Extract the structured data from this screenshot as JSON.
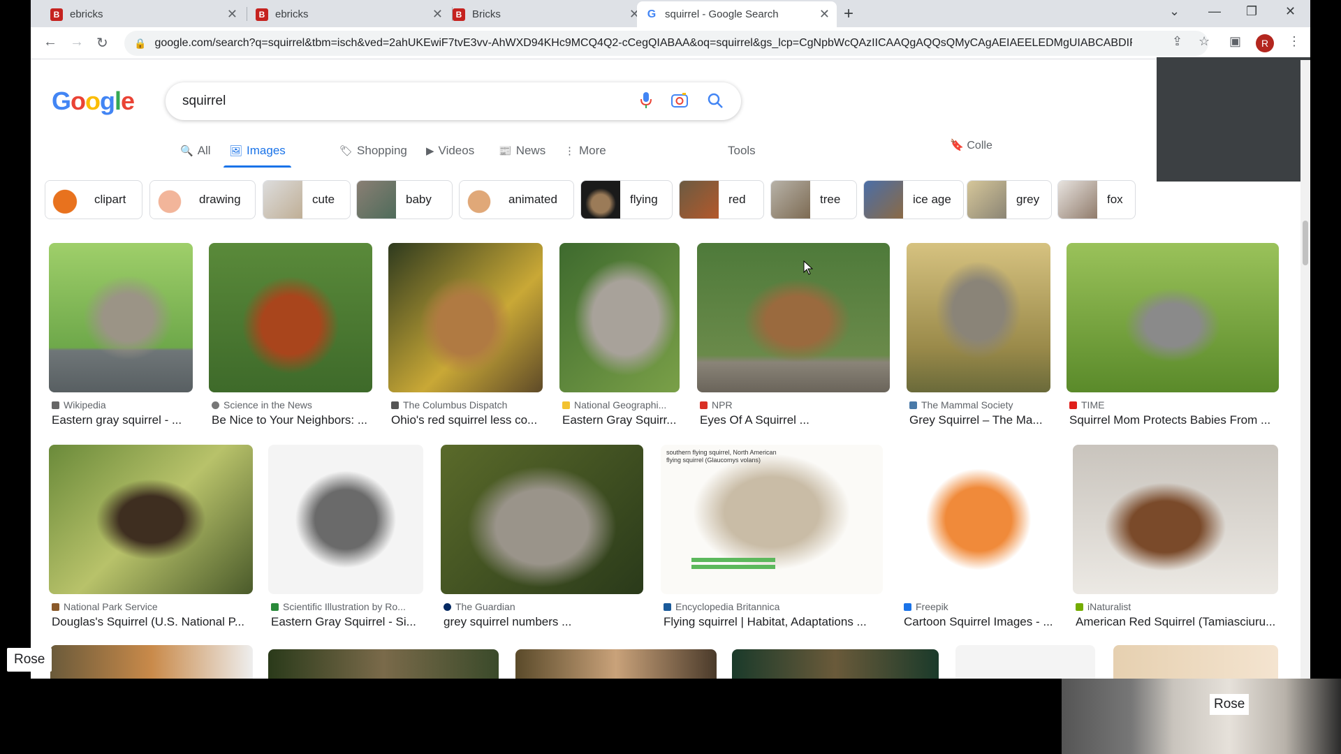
{
  "tabs": [
    {
      "title": "ebricks",
      "favicon": "B"
    },
    {
      "title": "ebricks",
      "favicon": "B"
    },
    {
      "title": "Bricks",
      "favicon": "B"
    },
    {
      "title": "squirrel - Google Search",
      "favicon": "G"
    }
  ],
  "address_bar": {
    "url": "google.com/search?q=squirrel&tbm=isch&ved=2ahUKEwiF7tvE3vv-AhWXD94KHc9MCQ4Q2-cCegQIABAA&oq=squirrel&gs_lcp=CgNpbWcQAzIICAAQgAQQsQMyCAgAEIAEELEDMgUIABCABDIFC..."
  },
  "profile_initial": "R",
  "logo_letters": [
    "G",
    "o",
    "o",
    "g",
    "l",
    "e"
  ],
  "search": {
    "query": "squirrel"
  },
  "nav_tabs": [
    "All",
    "Images",
    "Shopping",
    "Videos",
    "News",
    "More"
  ],
  "tools_label": "Tools",
  "collections_label": "Colle",
  "chips": [
    "clipart",
    "drawing",
    "cute",
    "baby",
    "animated",
    "flying",
    "red",
    "tree",
    "ice age",
    "grey",
    "fox"
  ],
  "row1": [
    {
      "source": "Wikipedia",
      "title": "Eastern gray squirrel - ..."
    },
    {
      "source": "Science in the News",
      "title": "Be Nice to Your Neighbors: ..."
    },
    {
      "source": "The Columbus Dispatch",
      "title": "Ohio's red squirrel less co..."
    },
    {
      "source": "National Geographi...",
      "title": "Eastern Gray Squirr..."
    },
    {
      "source": "NPR",
      "title": "Eyes Of A Squirrel ..."
    },
    {
      "source": "The Mammal Society",
      "title": "Grey Squirrel – The Ma..."
    },
    {
      "source": "TIME",
      "title": "Squirrel Mom Protects Babies From ..."
    }
  ],
  "row2": [
    {
      "source": "National Park Service",
      "title": "Douglas's Squirrel (U.S. National P..."
    },
    {
      "source": "Scientific Illustration by Ro...",
      "title": "Eastern Gray Squirrel - Si..."
    },
    {
      "source": "The Guardian",
      "title": "grey squirrel numbers ..."
    },
    {
      "source": "Encyclopedia Britannica",
      "title": "Flying squirrel | Habitat, Adaptations ..."
    },
    {
      "source": "Freepik",
      "title": "Cartoon Squirrel Images - ..."
    },
    {
      "source": "iNaturalist",
      "title": "American Red Squirrel (Tamiasciuru..."
    }
  ],
  "flying_squirrel_caption": "southern flying squirrel, North American flying squirrel (Glaucomys volans)",
  "participant_name": "Rose",
  "video_name": "Rose"
}
